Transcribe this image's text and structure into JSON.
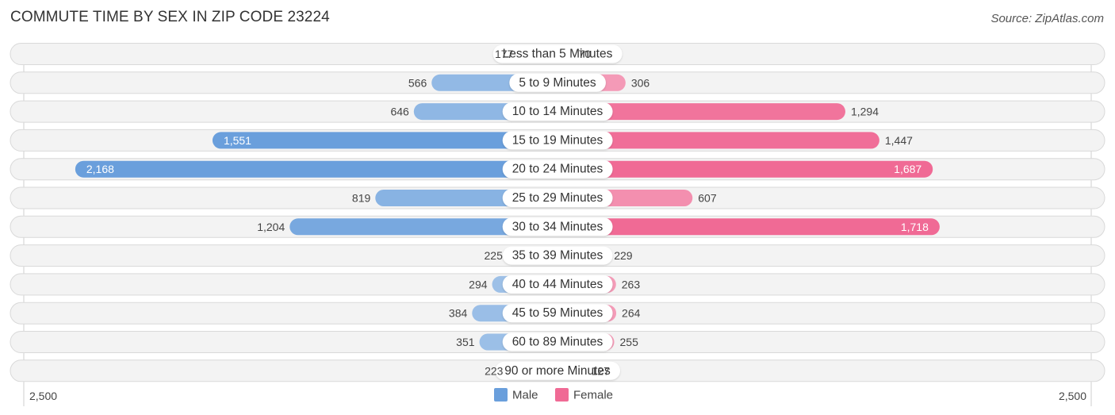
{
  "header": {
    "title": "COMMUTE TIME BY SEX IN ZIP CODE 23224",
    "source": "Source: ZipAtlas.com"
  },
  "colors": {
    "male_strong": "#6a9fdc",
    "male_light": "#a9c8ea",
    "female_strong": "#f06a95",
    "female_light": "#f5a6bf",
    "row_bg": "#f3f3f3"
  },
  "chart_data": {
    "type": "bar",
    "orientation": "horizontal-diverging",
    "title": "COMMUTE TIME BY SEX IN ZIP CODE 23224",
    "categories": [
      "Less than 5 Minutes",
      "5 to 9 Minutes",
      "10 to 14 Minutes",
      "15 to 19 Minutes",
      "20 to 24 Minutes",
      "25 to 29 Minutes",
      "30 to 34 Minutes",
      "35 to 39 Minutes",
      "40 to 44 Minutes",
      "45 to 59 Minutes",
      "60 to 89 Minutes",
      "90 or more Minutes"
    ],
    "series": [
      {
        "name": "Male",
        "side": "left",
        "values": [
          177,
          566,
          646,
          1551,
          2168,
          819,
          1204,
          225,
          294,
          384,
          351,
          223
        ],
        "labels": [
          "177",
          "566",
          "646",
          "1,551",
          "2,168",
          "819",
          "1,204",
          "225",
          "294",
          "384",
          "351",
          "223"
        ]
      },
      {
        "name": "Female",
        "side": "right",
        "values": [
          70,
          306,
          1294,
          1447,
          1687,
          607,
          1718,
          229,
          263,
          264,
          255,
          127
        ],
        "labels": [
          "70",
          "306",
          "1,294",
          "1,447",
          "1,687",
          "607",
          "1,718",
          "229",
          "263",
          "264",
          "255",
          "127"
        ]
      }
    ],
    "axis": {
      "left_label": "2,500",
      "right_label": "2,500",
      "max": 2500
    },
    "legend": {
      "position": "bottom-center",
      "items": [
        "Male",
        "Female"
      ]
    }
  }
}
